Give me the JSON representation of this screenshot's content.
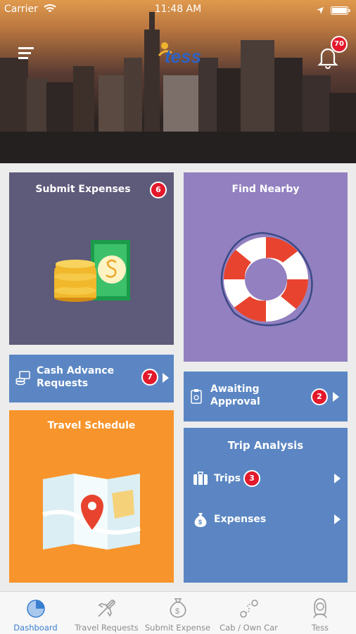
{
  "status_bar": {
    "carrier": "Carrier",
    "time": "11:48 AM"
  },
  "header": {
    "logo_text": "tess",
    "notification_count": "70"
  },
  "tiles": {
    "submit_expenses": {
      "title": "Submit Expenses",
      "badge": "6",
      "color": "#5e5a7a"
    },
    "find_nearby": {
      "title": "Find Nearby",
      "color": "#9280c0"
    },
    "cash_advance": {
      "label_line1": "Cash Advance",
      "label_line2": "Requests",
      "badge": "7",
      "color": "#5b86c3"
    },
    "awaiting_approval": {
      "label_line1": "Awaiting",
      "label_line2": "Approval",
      "badge": "2",
      "color": "#5b86c3"
    },
    "travel_schedule": {
      "title": "Travel Schedule",
      "color": "#f7942b"
    },
    "trip_analysis": {
      "title": "Trip Analysis",
      "trips_label": "Trips",
      "trips_badge": "3",
      "expenses_label": "Expenses",
      "color": "#5b86c3"
    }
  },
  "tabbar": {
    "active_color": "#3a7fcf",
    "items": [
      {
        "label": "Dashboard",
        "icon": "pie-chart-icon"
      },
      {
        "label": "Travel Requests",
        "icon": "airplane-icon"
      },
      {
        "label": "Submit Expense",
        "icon": "money-bag-icon"
      },
      {
        "label": "Cab / Own Car",
        "icon": "route-icon"
      },
      {
        "label": "Tess",
        "icon": "assistant-icon"
      }
    ]
  }
}
